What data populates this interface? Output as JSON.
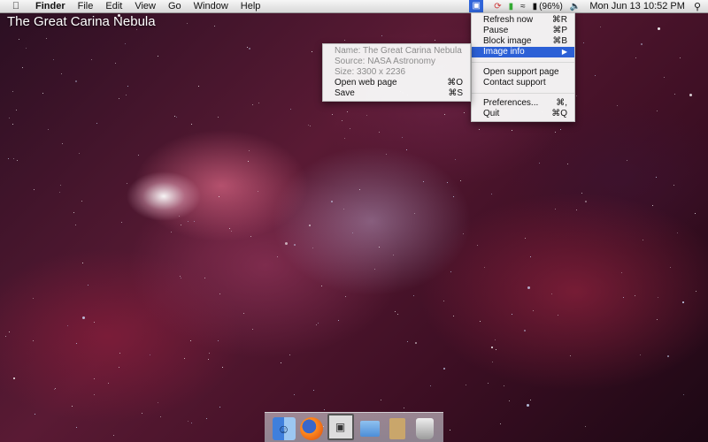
{
  "menubar": {
    "apple_icon": "apple-icon",
    "app_name": "Finder",
    "menus": [
      "File",
      "Edit",
      "View",
      "Go",
      "Window",
      "Help"
    ],
    "battery": "(96%)",
    "clock": "Mon Jun 13  10:52 PM"
  },
  "wallpaper": {
    "title": "The Great Carina Nebula"
  },
  "app_menu": {
    "items": [
      {
        "label": "Refresh now",
        "shortcut": "⌘R"
      },
      {
        "label": "Pause",
        "shortcut": "⌘P"
      },
      {
        "label": "Block image",
        "shortcut": "⌘B"
      },
      {
        "label": "Image info",
        "shortcut": "▶"
      },
      {
        "label": "Open support page",
        "shortcut": ""
      },
      {
        "label": "Contact support",
        "shortcut": ""
      },
      {
        "label": "Preferences...",
        "shortcut": "⌘,"
      },
      {
        "label": "Quit",
        "shortcut": "⌘Q"
      }
    ],
    "selected": "Image info"
  },
  "info_submenu": {
    "name": "Name: The Great Carina Nebula",
    "source": "Source: NASA Astronomy",
    "size": "Size: 3300 x 2236",
    "items": [
      {
        "label": "Open web page",
        "shortcut": "⌘O"
      },
      {
        "label": "Save",
        "shortcut": "⌘S"
      }
    ]
  },
  "dock": {
    "items": [
      "finder-icon",
      "firefox-icon",
      "preview-icon",
      "folder-icon",
      "documents-icon",
      "trash-icon"
    ]
  },
  "colors": {
    "selection": "#2c60d6",
    "menubar": "#e6e6e6"
  }
}
